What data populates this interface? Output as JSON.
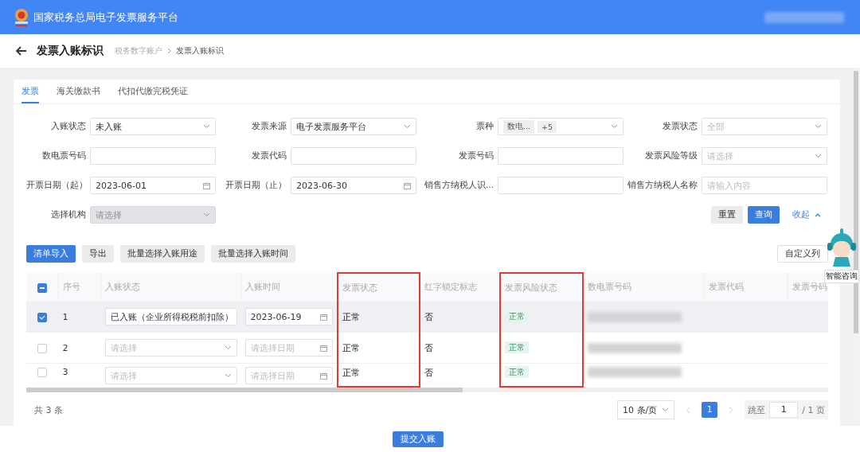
{
  "app_bar": {
    "title": "国家税务总局电子发票服务平台"
  },
  "page_header": {
    "title": "发票入账标识",
    "breadcrumb": [
      {
        "label": "税务数字账户",
        "current": false
      },
      {
        "label": "发票入账标识",
        "current": true
      }
    ]
  },
  "tabs": [
    {
      "label": "发票",
      "selected": true
    },
    {
      "label": "海关缴款书",
      "selected": false
    },
    {
      "label": "代扣代缴完税凭证",
      "selected": false
    }
  ],
  "filters": [
    {
      "label": "入账状态",
      "kind": "select",
      "value": "未入账",
      "disabled": false
    },
    {
      "label": "发票来源",
      "kind": "select",
      "value": "电子发票服务平台",
      "disabled": false
    },
    {
      "label": "票种",
      "kind": "tags",
      "tags": [
        "数电...",
        "+5"
      ],
      "disabled": false
    },
    {
      "label": "发票状态",
      "kind": "select",
      "placeholder": "全部",
      "disabled": false
    },
    {
      "label": "数电票号码",
      "kind": "input",
      "disabled": false
    },
    {
      "label": "发票代码",
      "kind": "input",
      "disabled": false
    },
    {
      "label": "发票号码",
      "kind": "input",
      "disabled": false
    },
    {
      "label": "发票风险等级",
      "kind": "select",
      "placeholder": "请选择",
      "disabled": false
    },
    {
      "label": "开票日期（起）",
      "kind": "date",
      "value": "2023-06-01",
      "disabled": false
    },
    {
      "label": "开票日期（止）",
      "kind": "date",
      "value": "2023-06-30",
      "disabled": false
    },
    {
      "label": "销售方纳税人识...",
      "kind": "input",
      "disabled": false
    },
    {
      "label": "销售方纳税人名称",
      "kind": "input",
      "placeholder": "请输入内容",
      "disabled": false
    },
    {
      "label": "选择机构",
      "kind": "select",
      "placeholder": "请选择",
      "disabled": true
    }
  ],
  "filter_actions": {
    "reset": "重置",
    "search": "查询",
    "collapse": "收起"
  },
  "toolbar": [
    {
      "label": "清单导入",
      "primary": true
    },
    {
      "label": "导出",
      "primary": false
    },
    {
      "label": "批量选择入账用途",
      "primary": false
    },
    {
      "label": "批量选择入账时间",
      "primary": false
    }
  ],
  "customize_columns": "自定义列",
  "table": {
    "select_all_indeterminate": true,
    "columns": [
      {
        "label": "序号",
        "highlighted": false
      },
      {
        "label": "入账状态",
        "highlighted": false
      },
      {
        "label": "入账时间",
        "highlighted": false
      },
      {
        "label": "发票状态",
        "highlighted": true
      },
      {
        "label": "红字锁定标志",
        "highlighted": false
      },
      {
        "label": "发票风险状态",
        "highlighted": true
      },
      {
        "label": "数电票号码",
        "highlighted": false
      },
      {
        "label": "发票代码",
        "highlighted": false
      },
      {
        "label": "发票号码",
        "highlighted": false
      }
    ],
    "rows": [
      {
        "selected": true,
        "index": "1",
        "entry_status": {
          "value": "已入账（企业所得税税前扣除）"
        },
        "entry_time": {
          "value": "2023-06-19"
        },
        "invoice_status": "正常",
        "red_lock": "否",
        "risk_status": "正常"
      },
      {
        "selected": false,
        "index": "2",
        "entry_status": {
          "placeholder": "请选择"
        },
        "entry_time": {
          "placeholder": "请选择日期"
        },
        "invoice_status": "正常",
        "red_lock": "否",
        "risk_status": "正常"
      },
      {
        "selected": false,
        "index": "3",
        "entry_status": {
          "placeholder": "请选择"
        },
        "entry_time": {
          "placeholder": "请选择日期"
        },
        "invoice_status": "正常",
        "red_lock": "否",
        "risk_status": "正常"
      }
    ]
  },
  "footer": {
    "total": "共 3 条",
    "page_size": "10 条/页",
    "pages": [
      {
        "label": "1",
        "selected": true
      }
    ],
    "jump_label": "跳至",
    "jump_value": "1",
    "page_count": "/ 1 页"
  },
  "submit": "提交入账",
  "assistant": {
    "label": "智能咨询"
  }
}
